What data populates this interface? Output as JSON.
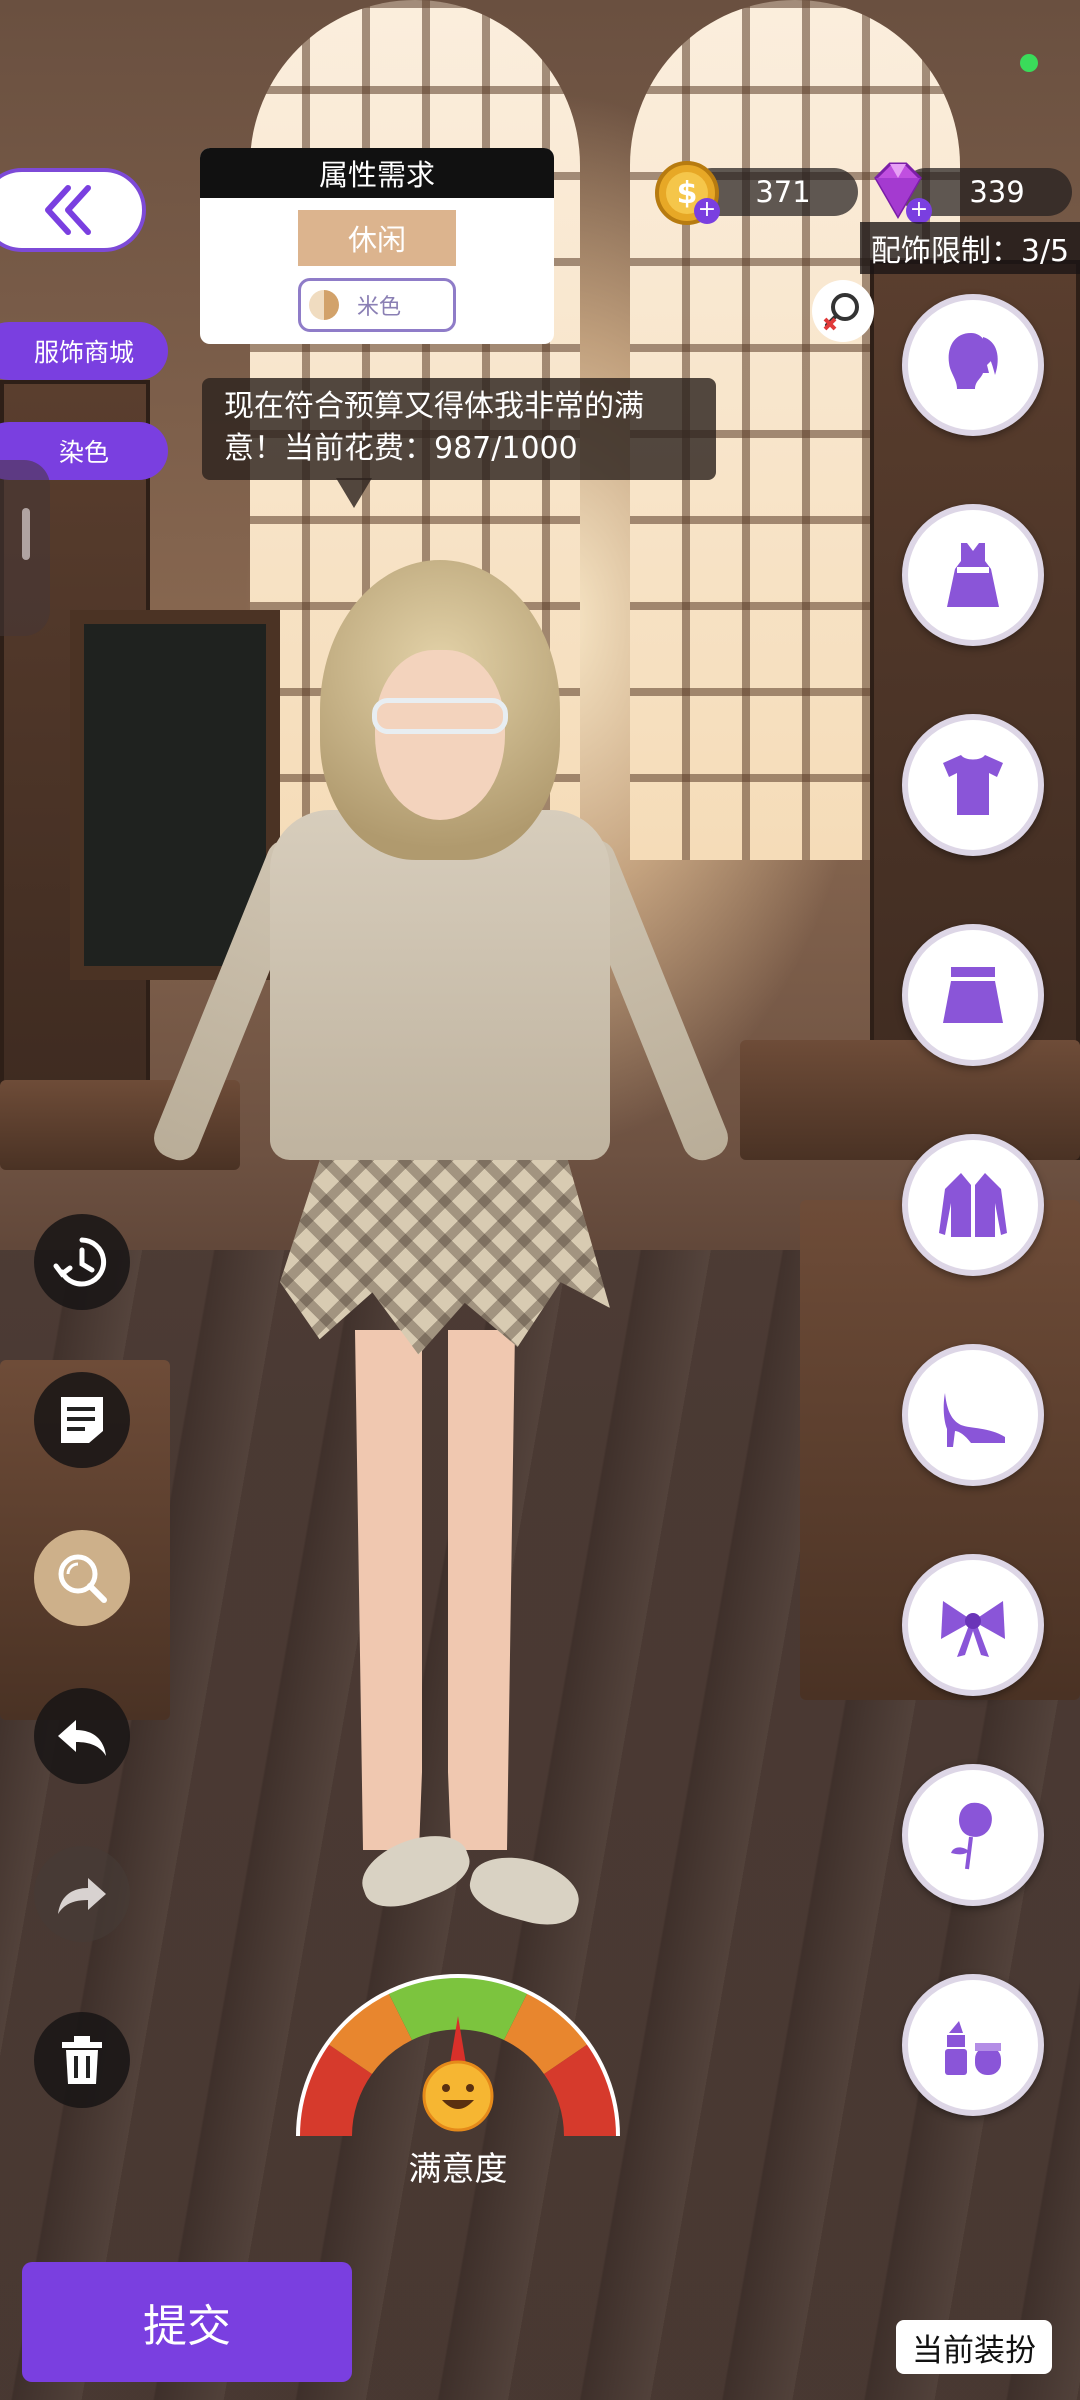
{
  "attribute_card": {
    "header": "属性需求",
    "style_tag": "休闲",
    "color_label": "米色"
  },
  "speech_bubble": {
    "text": "现在符合预算又得体我非常的满意！当前花费：987/1000"
  },
  "side_menu": {
    "shop_label": "服饰商城",
    "dye_label": "染色"
  },
  "currency": {
    "gold": "371",
    "gems": "339"
  },
  "accessory_limit": "配饰限制：3/5",
  "categories": [
    {
      "name": "hairstyle-icon"
    },
    {
      "name": "dress-icon"
    },
    {
      "name": "top-icon"
    },
    {
      "name": "skirt-icon"
    },
    {
      "name": "coat-icon"
    },
    {
      "name": "high-heel-icon"
    },
    {
      "name": "bow-icon"
    },
    {
      "name": "rose-icon"
    },
    {
      "name": "makeup-icon"
    }
  ],
  "tools": [
    "history-icon",
    "notes-icon",
    "search-icon",
    "undo-icon",
    "redo-icon",
    "trash-icon"
  ],
  "satisfaction": {
    "label": "满意度"
  },
  "footer": {
    "submit_label": "提交",
    "current_outfit_label": "当前装扮"
  },
  "colors": {
    "accent": "#7a3fe0",
    "tag_beige": "#dcb48e",
    "status_dot": "#3adb5a"
  }
}
